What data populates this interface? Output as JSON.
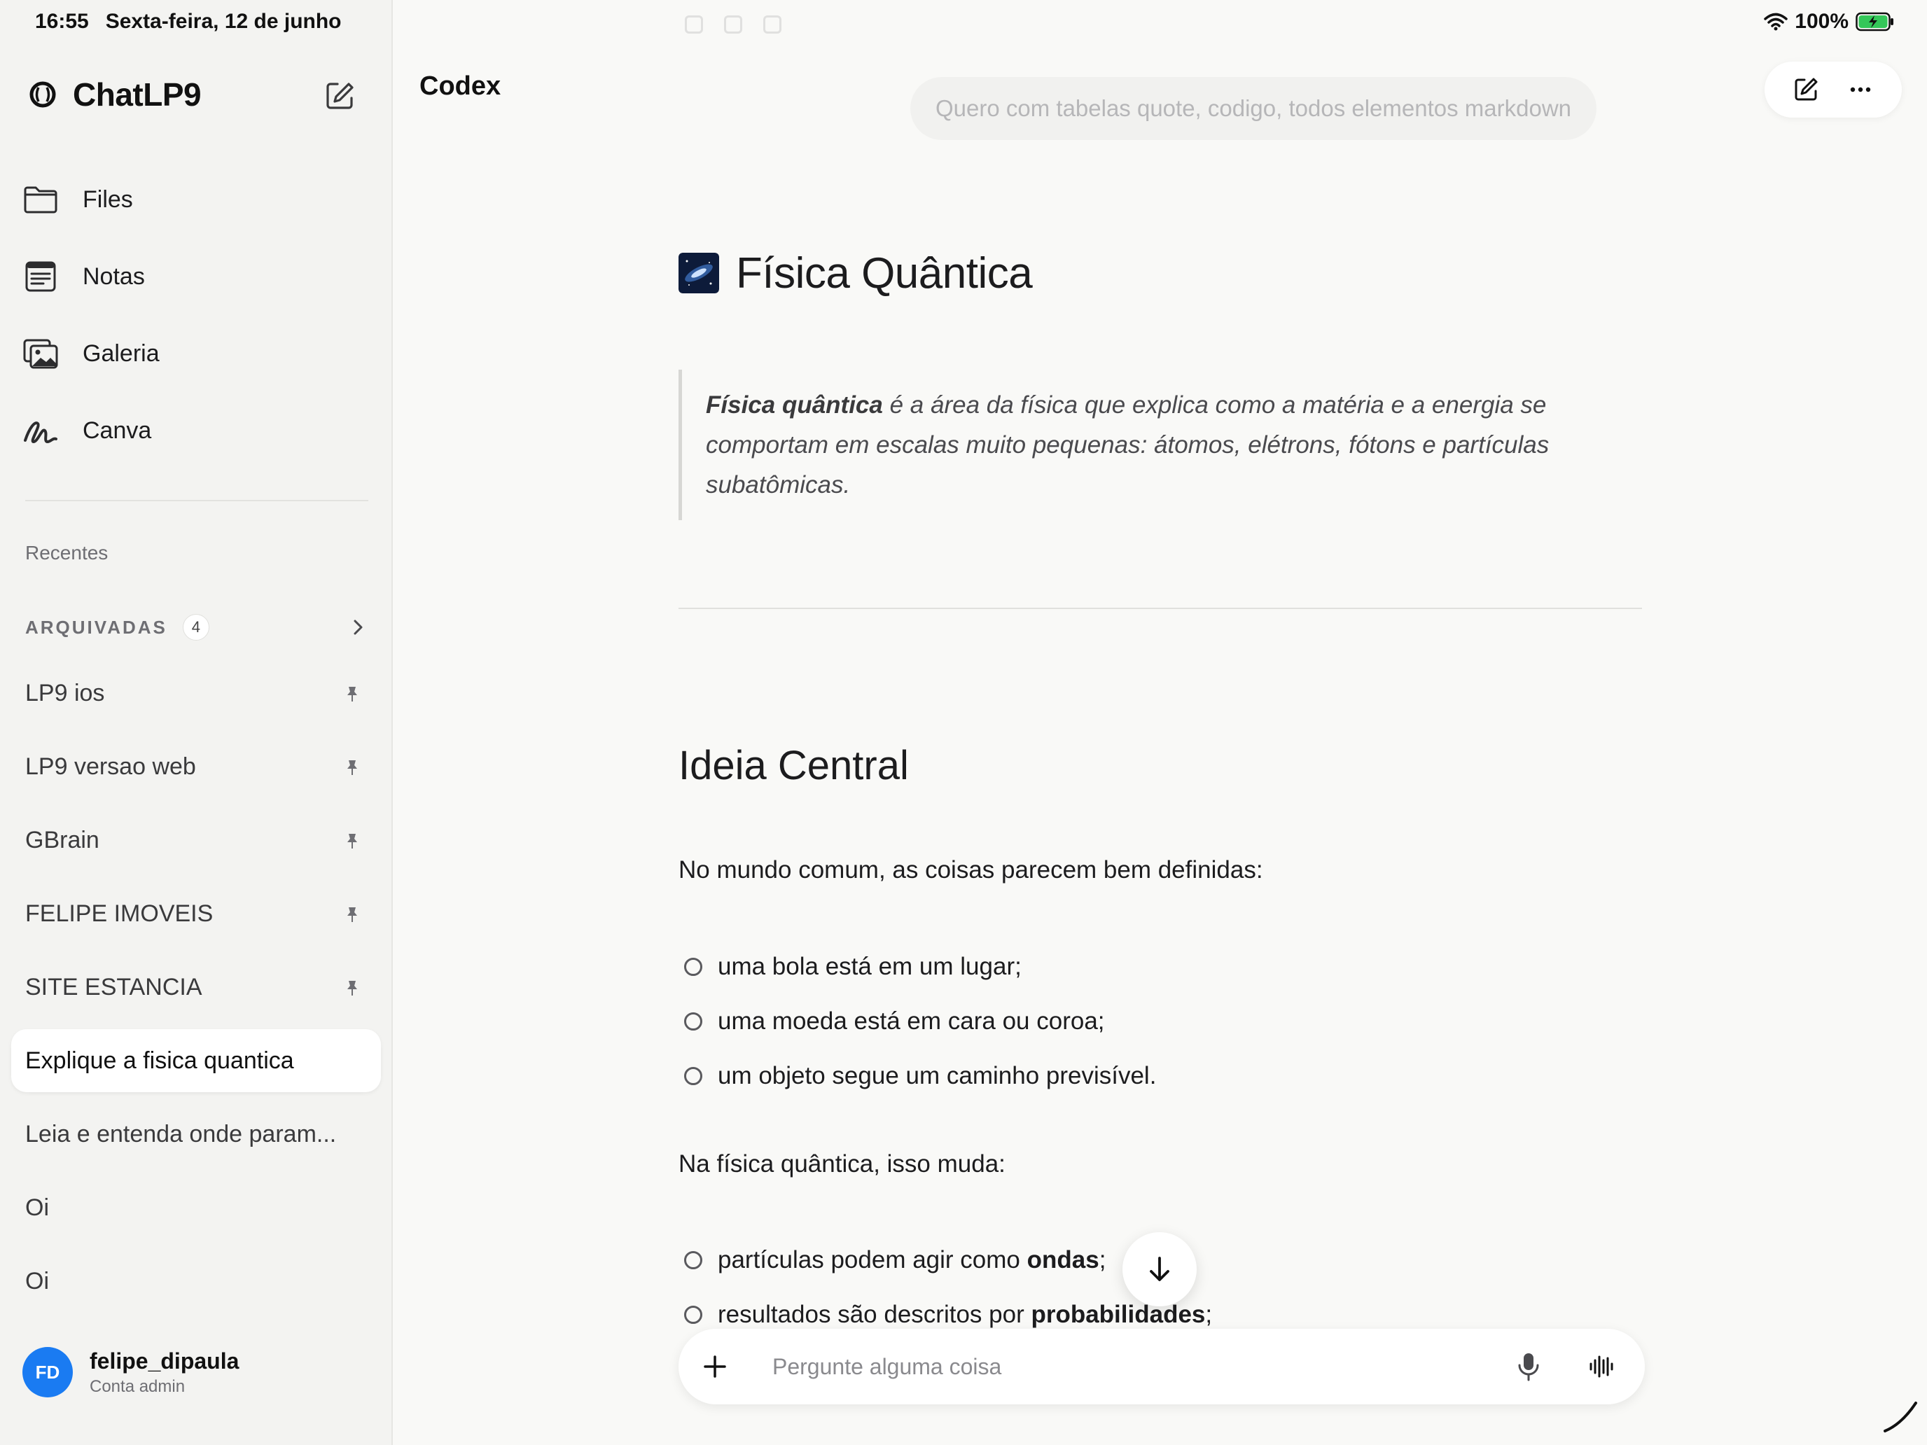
{
  "status_bar": {
    "time": "16:55",
    "date": "Sexta-feira, 12 de junho",
    "battery": "100%"
  },
  "sidebar": {
    "brand": "ChatLP9",
    "nav": [
      {
        "label": "Files",
        "icon": "folder-icon"
      },
      {
        "label": "Notas",
        "icon": "notes-icon"
      },
      {
        "label": "Galeria",
        "icon": "gallery-icon"
      },
      {
        "label": "Canva",
        "icon": "canva-icon"
      }
    ],
    "recent_label": "Recentes",
    "archived": {
      "label": "ARQUIVADAS",
      "count": "4"
    },
    "conversations": [
      {
        "label": "LP9 ios",
        "pinned": true
      },
      {
        "label": "LP9 versao web",
        "pinned": true
      },
      {
        "label": "GBrain",
        "pinned": true
      },
      {
        "label": "FELIPE IMOVEIS",
        "pinned": true
      },
      {
        "label": "SITE ESTANCIA",
        "pinned": true
      },
      {
        "label": "Explique a fisica quantica",
        "pinned": false,
        "active": true
      },
      {
        "label": "Leia e entenda onde param...",
        "pinned": false
      },
      {
        "label": "Oi",
        "pinned": false
      },
      {
        "label": "Oi",
        "pinned": false
      }
    ],
    "user": {
      "initials": "FD",
      "name": "felipe_dipaula",
      "role": "Conta admin"
    }
  },
  "main": {
    "title": "Codex",
    "user_message": "Quero com tabelas quote, codigo, todos elementos markdown",
    "doc": {
      "title": "Física Quântica",
      "quote_bold": "Física quântica",
      "quote_rest": " é a área da física que explica como a matéria e a energia se comportam em escalas muito pequenas: átomos, elétrons, fótons e partículas subatômicas.",
      "h2": "Ideia Central",
      "para1": "No mundo comum, as coisas parecem bem definidas:",
      "list1": [
        "uma bola está em um lugar;",
        "uma moeda está em cara ou coroa;",
        "um objeto segue um caminho previsível."
      ],
      "para2": "Na física quântica, isso muda:",
      "list2": [
        {
          "pre": "partículas podem agir como ",
          "bold": "ondas",
          "post": ";"
        },
        {
          "pre": "resultados são descritos por ",
          "bold": "probabilidades",
          "post": ";"
        }
      ]
    },
    "composer": {
      "placeholder": "Pergunte alguma coisa",
      "value": ""
    }
  },
  "colors": {
    "accent": "#1a7bf2",
    "battery": "#34c759"
  }
}
